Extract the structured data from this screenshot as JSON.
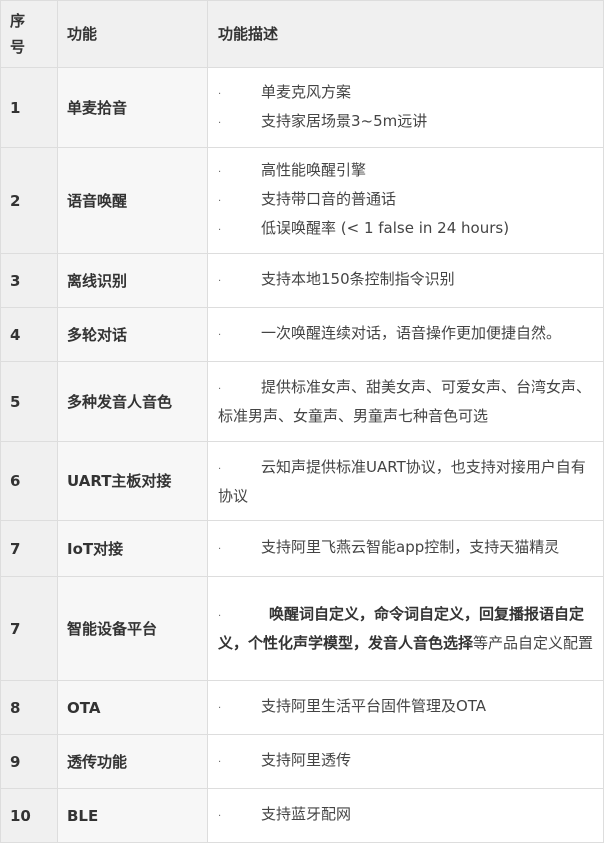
{
  "table": {
    "headers": {
      "index_line1": "序",
      "index_line2": "号",
      "feature": "功能",
      "description": "功能描述"
    },
    "bullet": "·",
    "rows": [
      {
        "index": "1",
        "feature": "单麦拾音",
        "lines": [
          "单麦克风方案",
          "支持家居场景3~5m远讲"
        ]
      },
      {
        "index": "2",
        "feature": "语音唤醒",
        "lines": [
          "高性能唤醒引擎",
          "支持带口音的普通话",
          "低误唤醒率 (< 1 false in 24 hours)"
        ]
      },
      {
        "index": "3",
        "feature": "离线识别",
        "lines": [
          "支持本地150条控制指令识别"
        ]
      },
      {
        "index": "4",
        "feature": "多轮对话",
        "lines": [
          "一次唤醒连续对话，语音操作更加便捷自然。"
        ]
      },
      {
        "index": "5",
        "feature": "多种发音人音色",
        "text": "提供标准女声、甜美女声、可爱女声、台湾女声、标准男声、女童声、男童声七种音色可选"
      },
      {
        "index": "6",
        "feature": "UART主板对接",
        "text": "云知声提供标准UART协议，也支持对接用户自有协议"
      },
      {
        "index": "7",
        "feature": "IoT对接",
        "lines": [
          "支持阿里飞燕云智能app控制，支持天猫精灵"
        ]
      },
      {
        "index": "7",
        "feature": "智能设备平台",
        "bold_text": "唤醒词自定义，命令词自定义，回复播报语自定义，个性化声学模型，发音人音色选择",
        "text": "等产品自定义配置"
      },
      {
        "index": "8",
        "feature": "OTA",
        "lines": [
          "支持阿里生活平台固件管理及OTA"
        ]
      },
      {
        "index": "9",
        "feature": "透传功能",
        "lines": [
          "支持阿里透传"
        ]
      },
      {
        "index": "10",
        "feature": "BLE",
        "lines": [
          "支持蓝牙配网"
        ]
      }
    ]
  }
}
